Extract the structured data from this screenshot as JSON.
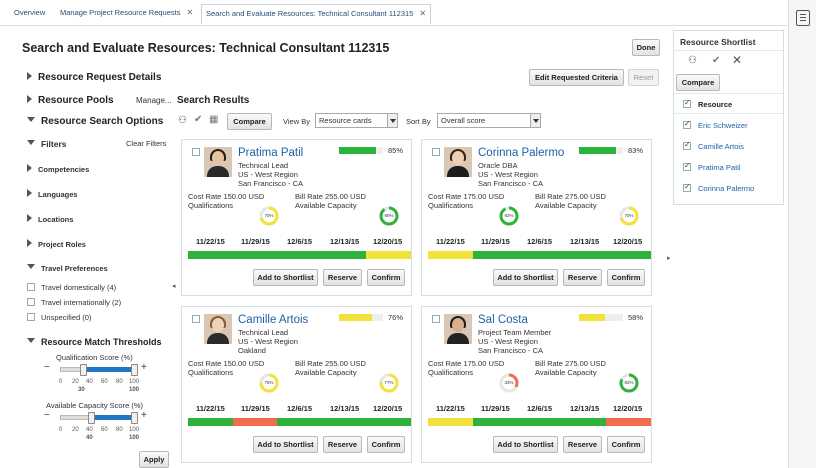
{
  "tabs": [
    {
      "label": "Overview"
    },
    {
      "label": "Manage Project Resource Requests"
    },
    {
      "label": "Search and Evaluate Resources: Technical Consultant 112315"
    }
  ],
  "page": {
    "title": "Search and Evaluate Resources: Technical Consultant 112315",
    "done_label": "Done",
    "edit_criteria_label": "Edit Requested Criteria",
    "reset_label": "Reset"
  },
  "sections": {
    "request_details": "Resource Request Details",
    "resource_pools": "Resource Pools",
    "manage_link": "Manage...",
    "search_options": "Resource Search Options",
    "search_results": "Search Results"
  },
  "filters": {
    "title": "Filters",
    "clear_label": "Clear Filters",
    "groups": [
      "Competencies",
      "Languages",
      "Locations",
      "Project Roles"
    ],
    "travel_title": "Travel Preferences",
    "travel_options": [
      {
        "label": "Travel domestically (4)"
      },
      {
        "label": "Travel internationally (2)"
      },
      {
        "label": "Unspecified (0)"
      }
    ],
    "thresholds_title": "Resource Match Thresholds",
    "qual_label": "Qualification Score (%)",
    "qual_ticks": [
      "0",
      "20",
      "40",
      "60",
      "80",
      "100"
    ],
    "qual_min": "30",
    "qual_max": "100",
    "qual_range": [
      30,
      100
    ],
    "cap_label": "Available Capacity Score (%)",
    "cap_ticks": [
      "0",
      "20",
      "40",
      "60",
      "80",
      "100"
    ],
    "cap_min": "40",
    "cap_max": "100",
    "cap_range": [
      40,
      100
    ],
    "apply_label": "Apply"
  },
  "toolbar": {
    "compare_label": "Compare",
    "view_by_label": "View By",
    "view_by_value": "Resource cards",
    "sort_by_label": "Sort By",
    "sort_by_value": "Overall score"
  },
  "dates": [
    "11/22/15",
    "11/29/15",
    "12/6/15",
    "12/13/15",
    "12/20/15"
  ],
  "card_labels": {
    "cost_rate": "Cost Rate",
    "bill_rate": "Bill Rate",
    "qualifications": "Qualifications",
    "available_capacity": "Available Capacity",
    "add_shortlist": "Add to Shortlist",
    "reserve": "Reserve",
    "confirm": "Confirm"
  },
  "cards": [
    {
      "name": "Pratima Patil",
      "role": "Technical Lead",
      "region": "US - West Region",
      "city": "San Francisco - CA",
      "score": "85%",
      "score_value": 85,
      "score_color": "#2db23c",
      "cost_rate": "150.00 USD",
      "bill_rate": "255.00 USD",
      "qual_pct": "70%",
      "qual_value": 70,
      "qual_color": "#f3e23a",
      "cap_pct": "90%",
      "cap_value": 90,
      "cap_color": "#2db23c",
      "availability": [
        "#2db23c",
        "#2db23c",
        "#2db23c",
        "#2db23c",
        "#f3e23a"
      ],
      "skin": "#e6c4a2",
      "hair": "#2b1d14",
      "clothes": "#2a2a2a"
    },
    {
      "name": "Corinna Palermo",
      "role": "Oracle DBA",
      "region": "US - West Region",
      "city": "San Francisco - CA",
      "score": "83%",
      "score_value": 83,
      "score_color": "#2db23c",
      "cost_rate": "175.00 USD",
      "bill_rate": "275.00 USD",
      "qual_pct": "92%",
      "qual_value": 92,
      "qual_color": "#2db23c",
      "cap_pct": "70%",
      "cap_value": 70,
      "cap_color": "#f3e23a",
      "availability": [
        "#f3e23a",
        "#2db23c",
        "#2db23c",
        "#2db23c",
        "#2db23c"
      ],
      "skin": "#edd0b3",
      "hair": "#3b2417",
      "clothes": "#1d1d1d"
    },
    {
      "name": "Camille Artois",
      "role": "Technical Lead",
      "region": "US - West Region",
      "city": "Oakland",
      "score": "76%",
      "score_value": 76,
      "score_color": "#f3e23a",
      "cost_rate": "150.00 USD",
      "bill_rate": "255.00 USD",
      "qual_pct": "75%",
      "qual_value": 75,
      "qual_color": "#f3e23a",
      "cap_pct": "77%",
      "cap_value": 77,
      "cap_color": "#f3e23a",
      "availability": [
        "#2db23c",
        "#f26c4f",
        "#2db23c",
        "#2db23c",
        "#2db23c"
      ],
      "skin": "#f0d3b5",
      "hair": "#8a5a33",
      "clothes": "#2a2a2a"
    },
    {
      "name": "Sal Costa",
      "role": "Project Team Member",
      "region": "US - West Region",
      "city": "San Francisco - CA",
      "score": "58%",
      "score_value": 58,
      "score_color": "#f3e23a",
      "cost_rate": "175.00 USD",
      "bill_rate": "275.00 USD",
      "qual_pct": "33%",
      "qual_value": 33,
      "qual_color": "#f26c4f",
      "cap_pct": "82%",
      "cap_value": 82,
      "cap_color": "#2db23c",
      "availability": [
        "#f3e23a",
        "#2db23c",
        "#2db23c",
        "#2db23c",
        "#f26c4f"
      ],
      "skin": "#d9b08c",
      "hair": "#1f1f1f",
      "clothes": "#222222"
    }
  ],
  "shortlist": {
    "title": "Resource Shortlist",
    "compare_label": "Compare",
    "header": "Resource",
    "items": [
      "Eric Schweizer",
      "Camille Artois",
      "Pratima Patil",
      "Corinna Palermo"
    ]
  }
}
